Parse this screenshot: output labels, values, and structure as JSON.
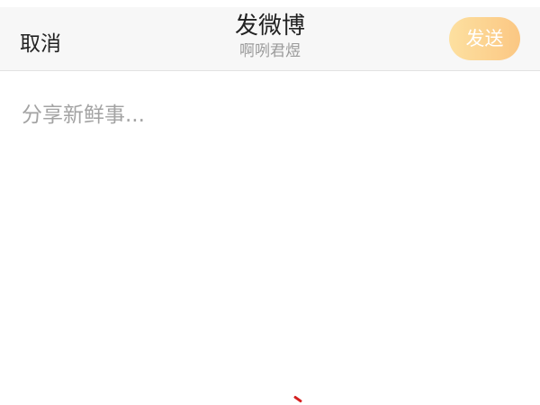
{
  "header": {
    "cancel_label": "取消",
    "title": "发微博",
    "subtitle": "啊咧君煜",
    "send_label": "发送"
  },
  "composer": {
    "placeholder": "分享新鲜事...",
    "value": ""
  },
  "colors": {
    "send_gradient_start": "#fde0a0",
    "send_gradient_end": "#fbc783",
    "topbar_bg": "#f7f7f7",
    "placeholder": "#a3a3a3"
  }
}
